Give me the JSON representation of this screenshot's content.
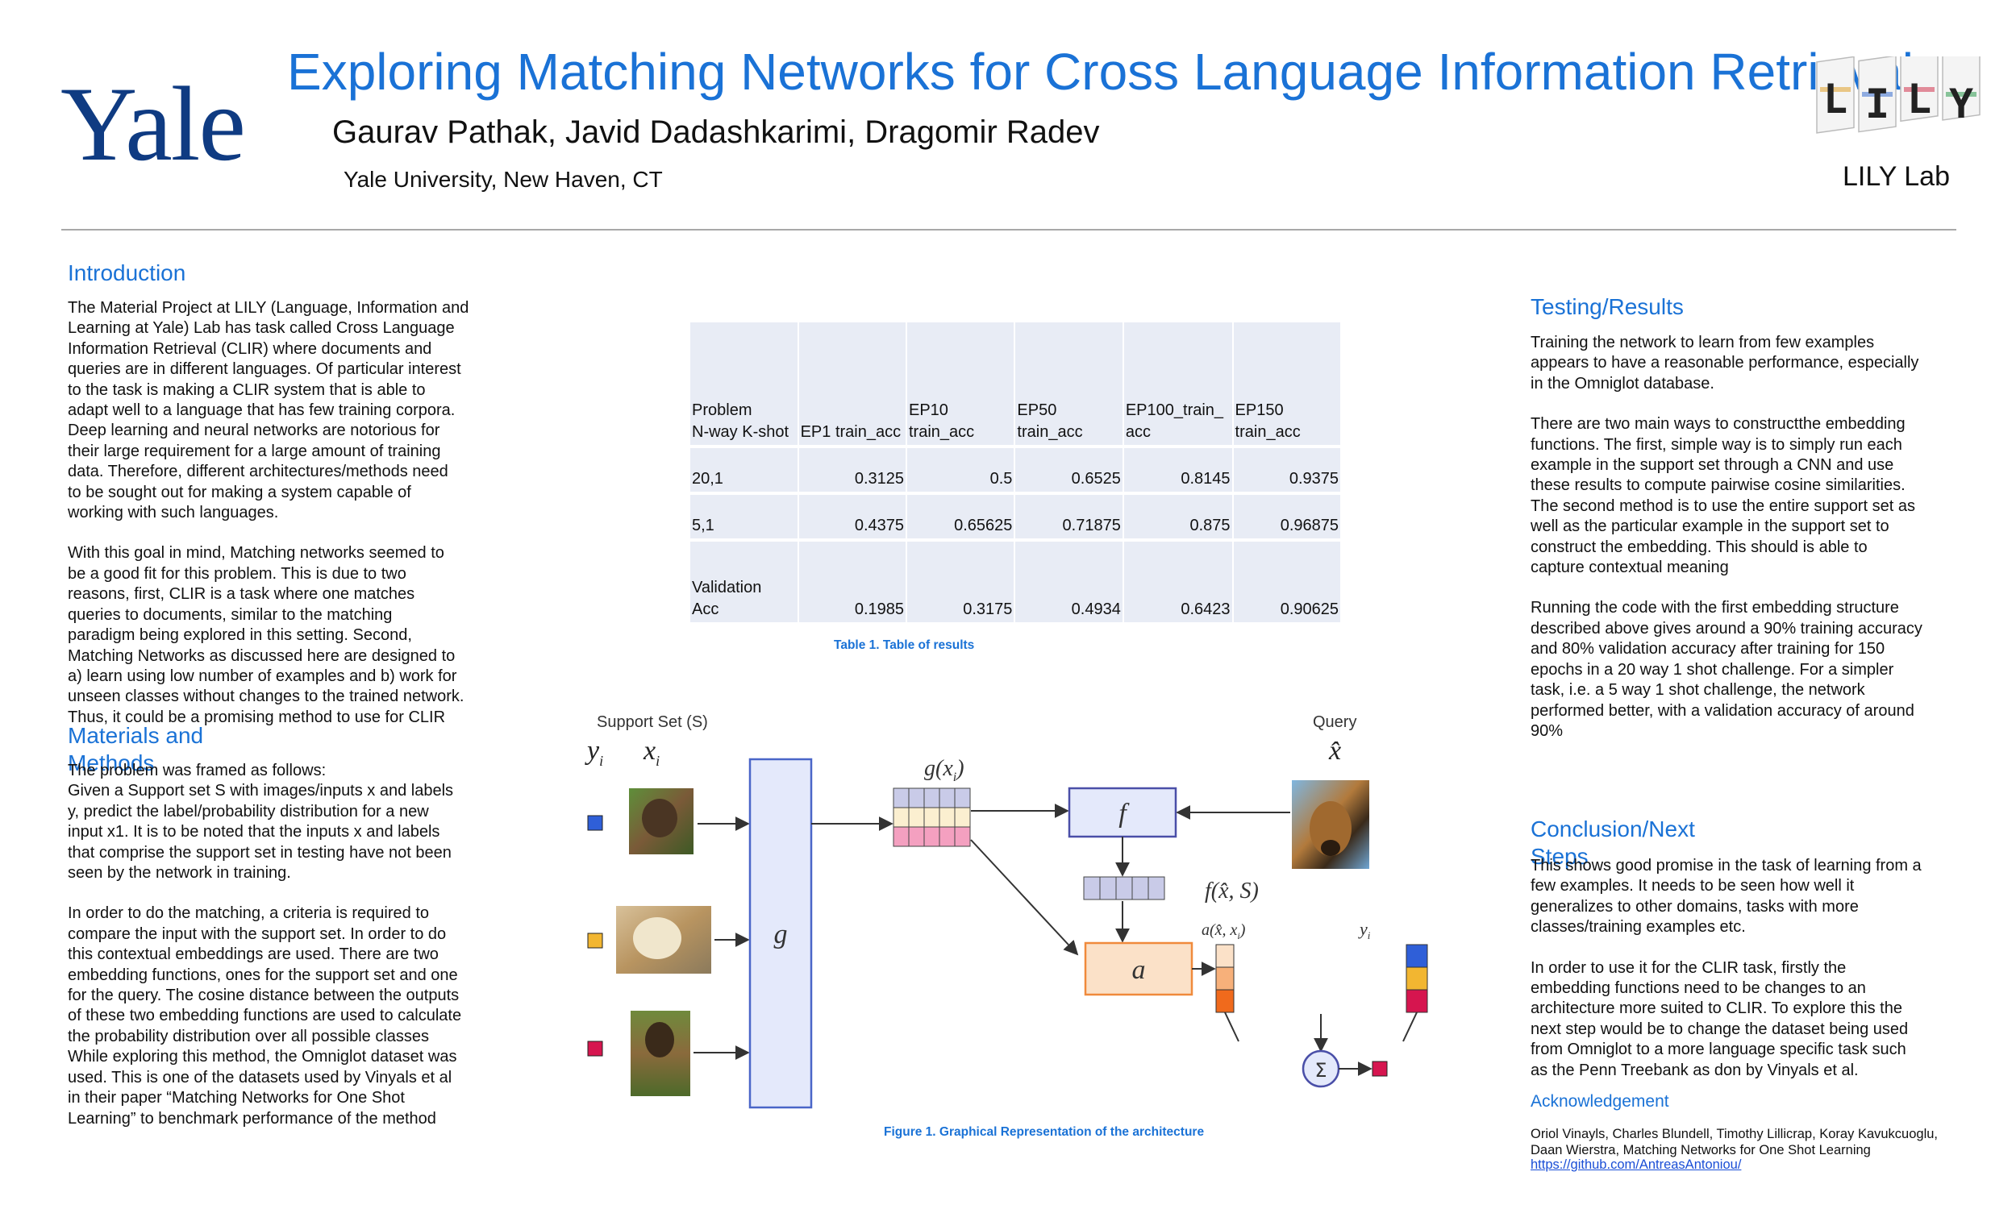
{
  "header": {
    "logo_text": "Yale",
    "title": "Exploring Matching Networks for Cross Language Information Retrieval",
    "authors": "Gaurav Pathak, Javid Dadashkarimi, Dragomir Radev",
    "affiliation": "Yale University, New Haven, CT",
    "lab_caption": "LILY Lab",
    "lab_logo_letters": [
      "L",
      "I",
      "L",
      "Y"
    ]
  },
  "introduction": {
    "heading": "Introduction",
    "paragraphs": [
      "The Material Project at LILY (Language, Information and\nLearning at Yale) Lab has task called Cross Language\nInformation Retrieval (CLIR) where documents and\nqueries are in different languages. Of particular interest\nto the task is making a CLIR system that is able to\nadapt well to a language that has few training corpora.\nDeep learning and neural networks are notorious for\ntheir large requirement for a large amount of training\ndata. Therefore, different architectures/methods need\nto be sought out for making a system capable of\nworking with such languages.",
      "With this goal in mind, Matching networks seemed to\nbe a good fit for this problem. This is due to two\nreasons, first, CLIR is a task where one matches\nqueries to documents, similar to the matching\nparadigm being explored in this setting. Second,\nMatching Networks as discussed here are designed to\na) learn using low number of examples and b) work for\nunseen classes without changes to the trained network.\nThus, it could be a promising method to use for CLIR"
    ]
  },
  "methods": {
    "heading": "Materials and Methods",
    "paragraphs": [
      "The problem was framed as follows:\nGiven a Support set S with images/inputs x and labels\ny, predict the label/probability distribution for a new\ninput x1. It is to be noted that the inputs x and labels\nthat comprise the support set in testing have not been\nseen by the network in training.",
      "In order to do the matching, a criteria is required to\ncompare the input with the support set. In order to do\nthis contextual embeddings are used. There are two\nembedding functions, ones for the support set and one\nfor the query. The cosine distance between the outputs\nof these two embedding functions are used to calculate\nthe probability distribution over all possible classes\nWhile exploring this method, the Omniglot dataset was\nused. This is one of the datasets used by Vinyals et al\nin their paper “Matching Networks for One Shot\nLearning” to benchmark performance of the method"
    ]
  },
  "results_table": {
    "headers": [
      "Problem\nN-way K-shot",
      "EP1 train_acc",
      "EP10\ntrain_acc",
      "EP50\ntrain_acc",
      "EP100_train_\nacc",
      "EP150\ntrain_acc"
    ],
    "rows": [
      [
        "20,1",
        "0.3125",
        "0.5",
        "0.6525",
        "0.8145",
        "0.9375"
      ],
      [
        "5,1",
        "0.4375",
        "0.65625",
        "0.71875",
        "0.875",
        "0.96875"
      ],
      [
        "Validation\nAcc",
        "0.1985",
        "0.3175",
        "0.4934",
        "0.6423",
        "0.90625"
      ]
    ],
    "caption": "Table 1. Table of results"
  },
  "figure": {
    "support_set_label": "Support Set (S)",
    "y_label": "y",
    "y_sub": "i",
    "x_label": "x",
    "x_sub": "i",
    "g_label": "g",
    "gx_label": "g(x",
    "gx_sub": "i",
    "gx_close": ")",
    "f_label": "f",
    "fx_label": "f(x̂, S)",
    "query_label": "Query",
    "xhat_label": "x̂",
    "a_label": "a",
    "ax_label": "a(x̂, x",
    "ax_close": ")",
    "yi_label": "y",
    "sum_label": "Σ",
    "colors": {
      "blue": "#2f5fd8",
      "yellow": "#f2b631",
      "crimson": "#d6154f",
      "pink": "#f4a0c0",
      "cream": "#fbefd0",
      "lavender": "#c9cbe8",
      "box_blue": "#e4e9fb",
      "orange": "#f7d2b0"
    },
    "caption": "Figure 1. Graphical Representation of the architecture"
  },
  "testing": {
    "heading": "Testing/Results",
    "paragraphs": [
      "Training the network to learn from few examples\nappears to have a reasonable performance, especially\nin the Omniglot database.",
      "There are two main ways to constructthe embedding\nfunctions. The first, simple way is to simply run each\nexample in the support set through a CNN and use\nthese results to compute pairwise cosine similarities.\nThe second method is to use the entire support set as\nwell as the particular example in the support set to\nconstruct the embedding. This should is able to\ncapture contextual meaning",
      "Running the code with the first embedding structure\ndescribed above gives around a 90% training accuracy\nand 80% validation accuracy after training for 150\nepochs in a 20 way 1 shot challenge. For a simpler\ntask, i.e. a 5 way 1 shot challenge, the network\nperformed better, with a validation accuracy of around\n90%"
    ]
  },
  "conclusion": {
    "heading": "Conclusion/Next Steps",
    "paragraphs": [
      "This shows good promise in the task of learning from a\nfew examples. It needs to be seen how well it\ngeneralizes to other domains, tasks with more\nclasses/training examples etc.",
      "In order to use it for the CLIR task, firstly the\nembedding functions need to be changes to an\narchitecture more suited to CLIR. To explore this the\nnext step would be to change the dataset being used\nfrom Omniglot to a more language specific task such\nas the Penn Treebank as don by Vinyals et al."
    ]
  },
  "acknowledgement": {
    "heading": "Acknowledgement",
    "text": "Oriol Vinayls, Charles Blundell, Timothy Lillicrap, Koray Kavukcuoglu,\nDaan Wierstra, Matching Networks for One Shot Learning",
    "link": "https://github.com/AntreasAntoniou/"
  }
}
